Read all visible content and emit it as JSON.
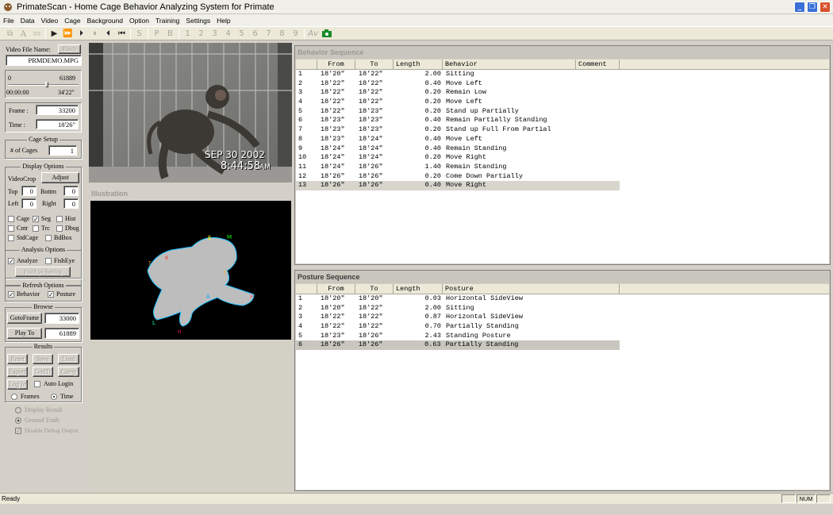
{
  "window": {
    "title": "PrimateScan - Home Cage Behavior Analyzing System for Primate"
  },
  "menu": [
    "File",
    "Data",
    "Video",
    "Cage",
    "Background",
    "Option",
    "Training",
    "Settings",
    "Help"
  ],
  "toolbar": {
    "letters": [
      "S",
      "P",
      "B",
      "1",
      "2",
      "3",
      "4",
      "5",
      "6",
      "7",
      "8",
      "9"
    ]
  },
  "left": {
    "video_file_label": "Video File Name:",
    "batch_button": "Batch",
    "file_name": "PRMDEMO.MPG",
    "range_start": "0",
    "range_end": "61889",
    "time_start": "00:00:00",
    "time_end": "34'22\"",
    "frame_label": "Frame :",
    "frame_value": "33200",
    "time_label": "Time :",
    "time_value": "18'26\"",
    "cage_setup_title": "Cage Setup",
    "num_cages_label": "# of Cages",
    "num_cages_value": "1",
    "display_options_title": "Display Options",
    "videocrop_label": "VideoCrop",
    "adjust_button": "Adjust",
    "top_label": "Top",
    "top_value": "0",
    "bottom_label": "Bottm",
    "bottom_value": "0",
    "left_label": "Left",
    "left_value": "0",
    "right_label": "Right",
    "right_value": "0",
    "cb_cage": "Cage",
    "cb_seg": "Seg",
    "cb_hist": "Hist",
    "cb_cntr": "Cntr",
    "cb_trc": "Trc",
    "cb_dbug": "Dbug",
    "cb_stdcage": "StdCage",
    "cb_bdbox": "BdBox",
    "analysis_title": "Analysis Options",
    "cb_analyze": "Analyze",
    "cb_fisheye": "FishEye",
    "fisheye_setting_button": "FishEye Setting",
    "refresh_title": "Refresh Options",
    "cb_behavior": "Behavior",
    "cb_posture": "Posture",
    "browse_title": "Browse",
    "goto_frame_button": "GotoFrame",
    "goto_frame_value": "33000",
    "play_to_button": "Play To",
    "play_to_value": "61889",
    "results_title": "Results",
    "reset_button": "Reset",
    "save_button": "Save",
    "load_button": "Load",
    "export_button": "Export",
    "gndtr_button": "GndTr",
    "comp_button": "Comp",
    "login_button": "Log In",
    "auto_login": "Auto Login",
    "frames_radio": "Frames",
    "time_radio": "Time",
    "display_result": "Display Result",
    "ground_truth": "Ground Truth",
    "disable_debug": "Disable Debug Output"
  },
  "video": {
    "date_stamp": "SEP 30 2002",
    "time_stamp": "8:44:58",
    "ampm": "AM"
  },
  "illustration": {
    "title": "Illustration",
    "labels": [
      {
        "text": "E",
        "color": "#ffff00"
      },
      {
        "text": "M",
        "color": "#00ff00"
      },
      {
        "text": "T",
        "color": "#ffaa00"
      },
      {
        "text": "B",
        "color": "#ff3030"
      },
      {
        "text": "T",
        "color": "#ffaa00"
      },
      {
        "text": "A",
        "color": "#00aaff"
      },
      {
        "text": "F",
        "color": "#ff4040"
      },
      {
        "text": "L",
        "color": "#00ffaa"
      },
      {
        "text": "H",
        "color": "#ff2060"
      }
    ]
  },
  "behavior": {
    "title": "Behavior Sequence",
    "columns": [
      "From",
      "To",
      "Length",
      "Behavior",
      "Comment"
    ],
    "rows": [
      [
        "1",
        "18'20\"",
        "18'22\"",
        "2.00",
        "Sitting"
      ],
      [
        "2",
        "18'22\"",
        "18'22\"",
        "0.40",
        "Move Left"
      ],
      [
        "3",
        "18'22\"",
        "18'22\"",
        "0.20",
        "Remain Low"
      ],
      [
        "4",
        "18'22\"",
        "18'22\"",
        "0.20",
        "Move Left"
      ],
      [
        "5",
        "18'22\"",
        "18'23\"",
        "0.20",
        "Stand up Partially"
      ],
      [
        "6",
        "18'23\"",
        "18'23\"",
        "0.40",
        "Remain Partially Standing"
      ],
      [
        "7",
        "18'23\"",
        "18'23\"",
        "0.20",
        "Stand up Full From Partial"
      ],
      [
        "8",
        "18'23\"",
        "18'24\"",
        "0.40",
        "Move Left"
      ],
      [
        "9",
        "18'24\"",
        "18'24\"",
        "0.40",
        "Remain Standing"
      ],
      [
        "10",
        "18'24\"",
        "18'24\"",
        "0.20",
        "Move Right"
      ],
      [
        "11",
        "18'24\"",
        "18'26\"",
        "1.40",
        "Remain Standing"
      ],
      [
        "12",
        "18'26\"",
        "18'26\"",
        "0.20",
        "Come Down Partially"
      ],
      [
        "13",
        "18'26\"",
        "18'26\"",
        "0.40",
        "Move Right"
      ]
    ]
  },
  "posture": {
    "title": "Posture Sequence",
    "columns": [
      "From",
      "To",
      "Length",
      "Posture"
    ],
    "rows": [
      [
        "1",
        "18'20\"",
        "18'20\"",
        "0.03",
        "Horizontal SideView"
      ],
      [
        "2",
        "18'20\"",
        "18'22\"",
        "2.00",
        "Sitting"
      ],
      [
        "3",
        "18'22\"",
        "18'22\"",
        "0.87",
        "Horizontal SideView"
      ],
      [
        "4",
        "18'22\"",
        "18'22\"",
        "0.70",
        "Partially Standing"
      ],
      [
        "5",
        "18'23\"",
        "18'26\"",
        "2.43",
        "Standing Posture"
      ],
      [
        "6",
        "18'26\"",
        "18'26\"",
        "0.63",
        "Partially Standing"
      ]
    ]
  },
  "status": {
    "text": "Ready",
    "num": "NUM"
  }
}
